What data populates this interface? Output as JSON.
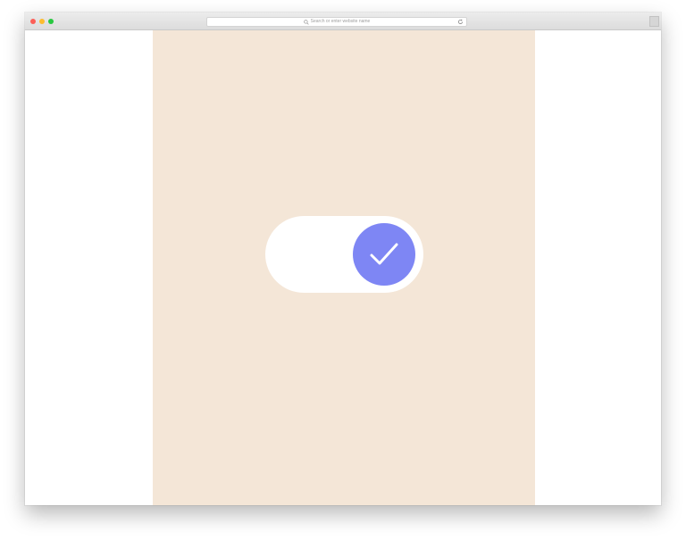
{
  "browser": {
    "address_bar_placeholder": "Search or enter website name"
  },
  "colors": {
    "panel_background": "#f4e6d7",
    "knob": "#7e86f4",
    "track": "#ffffff"
  },
  "toggle": {
    "state": "on",
    "knob_icon": "check-icon"
  }
}
